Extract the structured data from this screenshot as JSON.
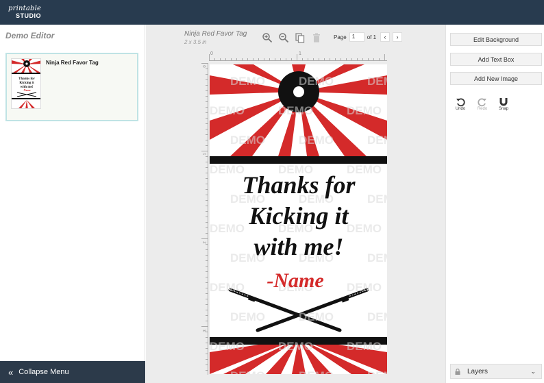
{
  "header": {
    "logo_line1": "printable",
    "logo_line2": "STUDIO"
  },
  "left_panel": {
    "title": "Demo Editor",
    "pages": [
      {
        "label": "Ninja Red Favor Tag"
      }
    ],
    "collapse_label": "Collapse Menu"
  },
  "toolbar": {
    "doc_title": "Ninja Red Favor Tag",
    "doc_size": "2 x 3.5 in",
    "icons": [
      "zoom-in-icon",
      "zoom-out-icon",
      "duplicate-icon",
      "trash-icon"
    ],
    "page_label": "Page",
    "page_value": "1",
    "page_of": "of 1"
  },
  "rulers": {
    "top": [
      "0",
      "1"
    ],
    "left": [
      "0",
      "1",
      "2",
      "3"
    ]
  },
  "canvas": {
    "watermark": "DEMO",
    "line1": "Thanks for",
    "line2": "Kicking it",
    "line3": "with me!",
    "name": "-Name",
    "colors": {
      "red": "#d42a2a",
      "black": "#111111"
    }
  },
  "right_panel": {
    "edit_background": "Edit Background",
    "add_text_box": "Add Text Box",
    "add_new_image": "Add New Image",
    "undo": "Undo",
    "redo": "Redo",
    "snap": "Snap",
    "layers": "Layers"
  }
}
